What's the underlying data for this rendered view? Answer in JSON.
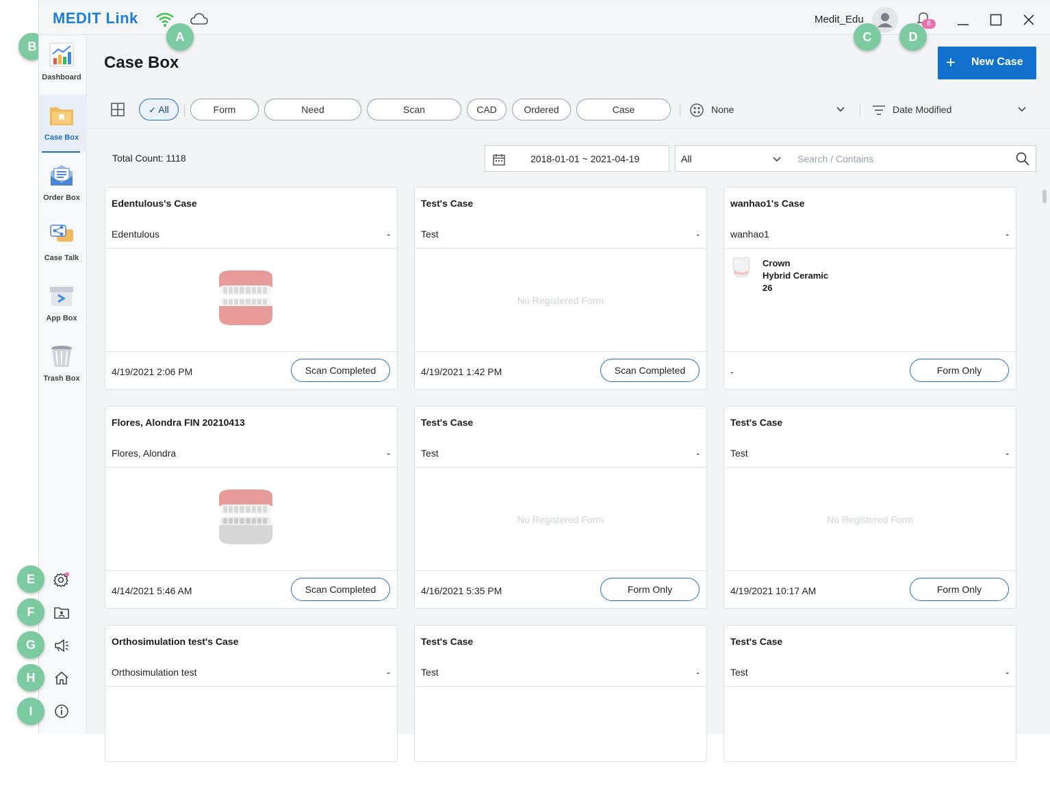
{
  "app": {
    "logo": "MEDIT Link"
  },
  "titlebar": {
    "user_name": "Medit_Edu",
    "notification_count": "8"
  },
  "sidebar": {
    "items": [
      {
        "label": "Dashboard",
        "icon": "dashboard-icon"
      },
      {
        "label": "Case Box",
        "icon": "case-box-icon",
        "active": true
      },
      {
        "label": "Order Box",
        "icon": "order-box-icon"
      },
      {
        "label": "Case Talk",
        "icon": "case-talk-icon"
      },
      {
        "label": "App Box",
        "icon": "app-box-icon"
      },
      {
        "label": "Trash Box",
        "icon": "trash-box-icon"
      }
    ],
    "tools": [
      "settings-icon",
      "folder-icon",
      "megaphone-icon",
      "home-icon",
      "info-icon"
    ]
  },
  "header": {
    "title": "Case Box",
    "new_case_label": "New Case"
  },
  "filters": {
    "chips": [
      "All",
      "Form",
      "Need",
      "Scan",
      "CAD",
      "Ordered",
      "Case"
    ],
    "active_chip": "All",
    "group_by": "None",
    "sort_by": "Date Modified"
  },
  "toolbar": {
    "total_count": "Total Count: 1118",
    "date_range": "2018-01-01 ~ 2021-04-19",
    "search_scope": "All",
    "search_placeholder": "Search / Contains"
  },
  "cases": [
    {
      "title": "Edentulous's Case",
      "patient": "Edentulous",
      "dash": "-",
      "body": "teeth",
      "date": "4/19/2021 2:06 PM",
      "status": "Scan Completed"
    },
    {
      "title": "Test's Case",
      "patient": "Test",
      "dash": "-",
      "body": "empty",
      "empty_text": "No Registered Form",
      "date": "4/19/2021 1:42 PM",
      "status": "Scan Completed"
    },
    {
      "title": "wanhao1's Case",
      "patient": "wanhao1",
      "dash": "-",
      "body": "form",
      "form_line1": "Crown",
      "form_line2": "Hybrid Ceramic",
      "form_line3": "26",
      "date": "-",
      "status": "Form Only"
    },
    {
      "title": "Flores, Alondra FIN 20210413",
      "patient": "Flores, Alondra",
      "dash": "-",
      "body": "teeth",
      "date": "4/14/2021 5:46 AM",
      "status": "Scan Completed"
    },
    {
      "title": "Test's Case",
      "patient": "Test",
      "dash": "-",
      "body": "empty",
      "empty_text": "No Registered Form",
      "date": "4/16/2021 5:35 PM",
      "status": "Form Only"
    },
    {
      "title": "Test's Case",
      "patient": "Test",
      "dash": "-",
      "body": "empty",
      "empty_text": "No Registered Form",
      "date": "4/19/2021 10:17 AM",
      "status": "Form Only"
    },
    {
      "title": "Orthosimulation test's Case",
      "patient": "Orthosimulation test",
      "dash": "-"
    },
    {
      "title": "Test's Case",
      "patient": "Test",
      "dash": "-"
    },
    {
      "title": "Test's Case",
      "patient": "Test",
      "dash": "-"
    }
  ],
  "markers": [
    "A",
    "B",
    "C",
    "D",
    "E",
    "F",
    "G",
    "H",
    "I"
  ],
  "colors": {
    "accent": "#1271cd",
    "marker": "#7ccaa0",
    "badge": "#ea6fb0",
    "wifi": "#3cc04a"
  }
}
